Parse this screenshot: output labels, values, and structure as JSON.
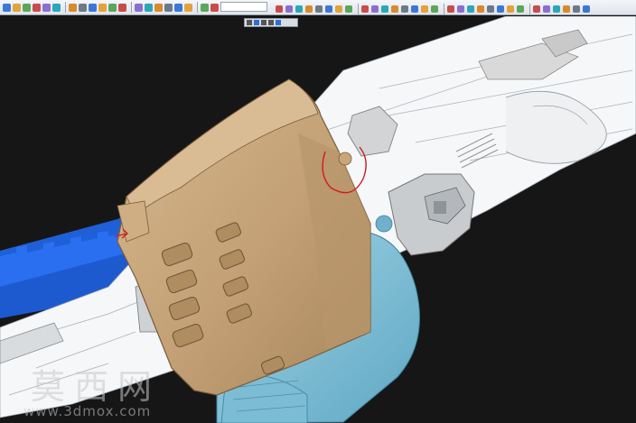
{
  "app": {
    "name": "CAD viewer",
    "title_field": "",
    "colors": {
      "background": "#161616",
      "blue_part": "#1f5fd8",
      "white_part": "#f4f6f8",
      "tan_part": "#c7a57a",
      "cyan_part": "#86c6dc",
      "annotation": "#d11a1a"
    }
  },
  "toolbar": {
    "icons": [
      "open-icon",
      "save-icon",
      "print-icon",
      "undo-icon",
      "redo-icon",
      "rotate-icon",
      "pan-icon",
      "zoom-icon",
      "zoom-fit-icon",
      "measure-icon",
      "section-icon",
      "view-front-icon",
      "view-top-icon",
      "view-iso-icon",
      "render-icon",
      "wireframe-icon",
      "light-icon",
      "camera-icon",
      "layers-icon",
      "settings-icon"
    ]
  },
  "subbar": {
    "icons": [
      "snap-icon",
      "grid-icon",
      "select-icon"
    ]
  },
  "watermark": {
    "chinese": "莫西网",
    "url": "www.3dmox.com"
  }
}
